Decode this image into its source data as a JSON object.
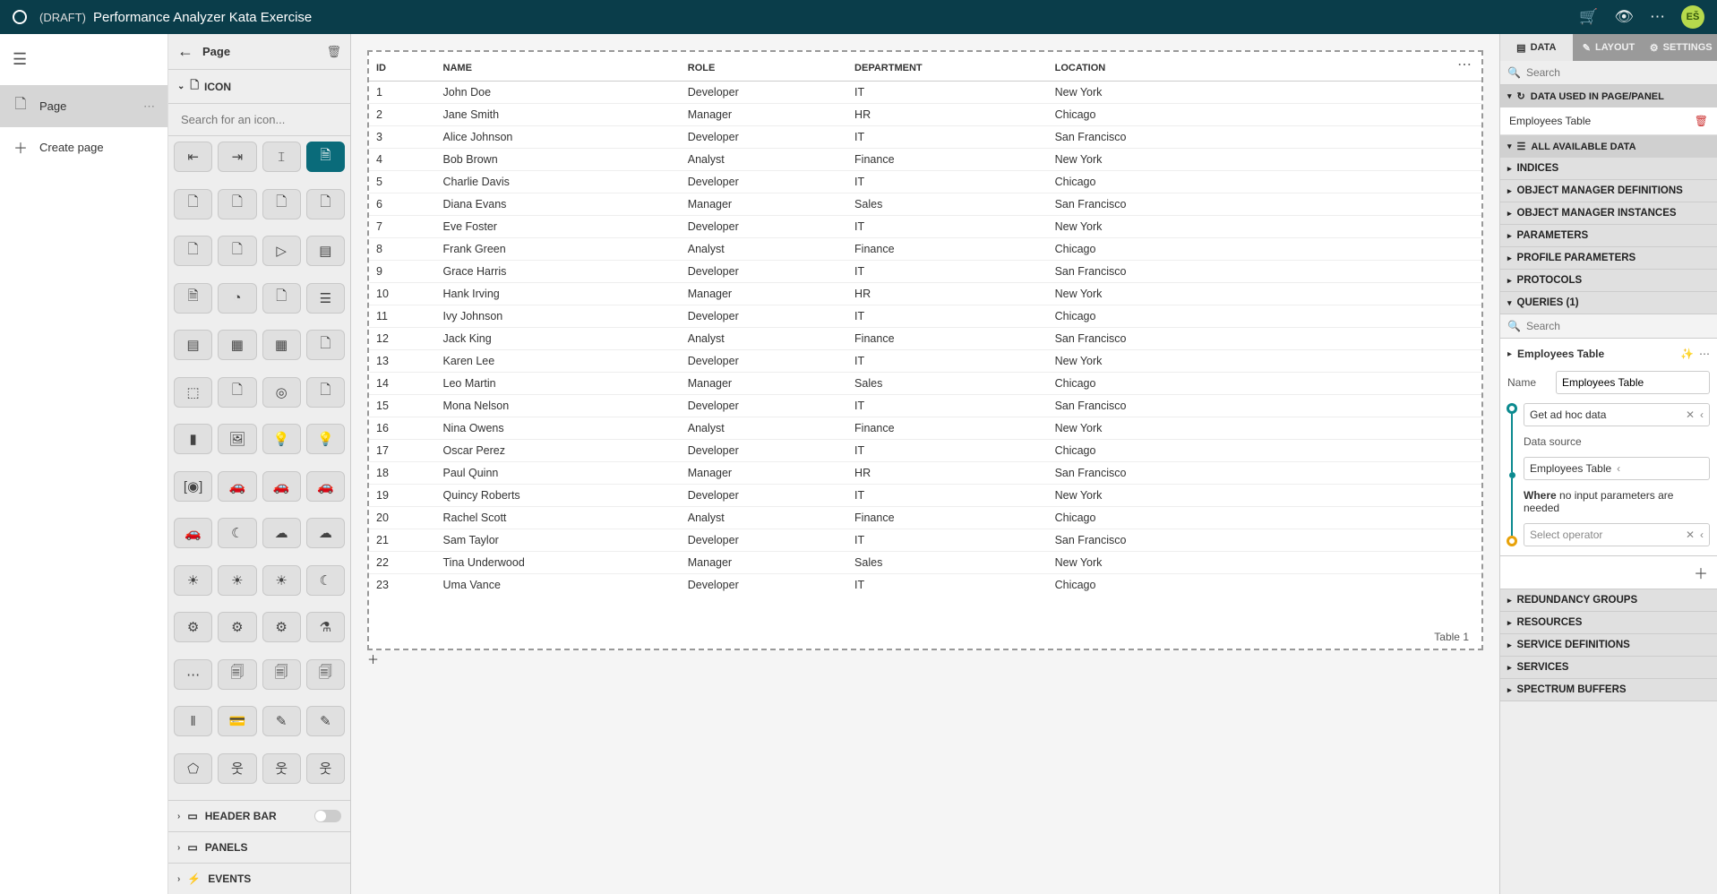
{
  "topbar": {
    "draft": "(DRAFT)",
    "title": "Performance Analyzer Kata Exercise",
    "avatar": "EŠ"
  },
  "nav": {
    "page": "Page",
    "create": "Create page"
  },
  "pagecol": {
    "title": "Page",
    "icon_section": "ICON",
    "search_placeholder": "Search for an icon...",
    "headerbar": "HEADER BAR",
    "panels": "PANELS",
    "events": "EVENTS",
    "icons": [
      "⇤",
      "⇥",
      "𝙸",
      "🗎",
      "🗋",
      "🗋",
      "🗋",
      "🗋",
      "🗋",
      "🗋",
      "▷",
      "▤",
      "🗎",
      "◔",
      "🗋",
      "☰",
      "▤",
      "▦",
      "▦",
      "🗋",
      "⬚",
      "🗋",
      "◎",
      "🗋",
      "▮",
      "🖼",
      "💡",
      "💡",
      "[◉]",
      "🚗",
      "🚗",
      "🚗",
      "🚗",
      "☾",
      "☁",
      "☁",
      "☀",
      "☀",
      "☀",
      "☾",
      "⚙",
      "⚙",
      "⚙",
      "⚗",
      "⋯",
      "🗐",
      "🗐",
      "🗐",
      "‖",
      "💳",
      "✎",
      "✎",
      "⬠",
      "웃",
      "웃",
      "웃"
    ]
  },
  "table": {
    "label": "Table 1",
    "headers": [
      "ID",
      "NAME",
      "ROLE",
      "DEPARTMENT",
      "LOCATION"
    ],
    "rows": [
      [
        "1",
        "John Doe",
        "Developer",
        "IT",
        "New York"
      ],
      [
        "2",
        "Jane Smith",
        "Manager",
        "HR",
        "Chicago"
      ],
      [
        "3",
        "Alice Johnson",
        "Developer",
        "IT",
        "San Francisco"
      ],
      [
        "4",
        "Bob Brown",
        "Analyst",
        "Finance",
        "New York"
      ],
      [
        "5",
        "Charlie Davis",
        "Developer",
        "IT",
        "Chicago"
      ],
      [
        "6",
        "Diana Evans",
        "Manager",
        "Sales",
        "San Francisco"
      ],
      [
        "7",
        "Eve Foster",
        "Developer",
        "IT",
        "New York"
      ],
      [
        "8",
        "Frank Green",
        "Analyst",
        "Finance",
        "Chicago"
      ],
      [
        "9",
        "Grace Harris",
        "Developer",
        "IT",
        "San Francisco"
      ],
      [
        "10",
        "Hank Irving",
        "Manager",
        "HR",
        "New York"
      ],
      [
        "11",
        "Ivy Johnson",
        "Developer",
        "IT",
        "Chicago"
      ],
      [
        "12",
        "Jack King",
        "Analyst",
        "Finance",
        "San Francisco"
      ],
      [
        "13",
        "Karen Lee",
        "Developer",
        "IT",
        "New York"
      ],
      [
        "14",
        "Leo Martin",
        "Manager",
        "Sales",
        "Chicago"
      ],
      [
        "15",
        "Mona Nelson",
        "Developer",
        "IT",
        "San Francisco"
      ],
      [
        "16",
        "Nina Owens",
        "Analyst",
        "Finance",
        "New York"
      ],
      [
        "17",
        "Oscar Perez",
        "Developer",
        "IT",
        "Chicago"
      ],
      [
        "18",
        "Paul Quinn",
        "Manager",
        "HR",
        "San Francisco"
      ],
      [
        "19",
        "Quincy Roberts",
        "Developer",
        "IT",
        "New York"
      ],
      [
        "20",
        "Rachel Scott",
        "Analyst",
        "Finance",
        "Chicago"
      ],
      [
        "21",
        "Sam Taylor",
        "Developer",
        "IT",
        "San Francisco"
      ],
      [
        "22",
        "Tina Underwood",
        "Manager",
        "Sales",
        "New York"
      ],
      [
        "23",
        "Uma Vance",
        "Developer",
        "IT",
        "Chicago"
      ]
    ]
  },
  "right": {
    "tabs": {
      "data": "DATA",
      "layout": "LAYOUT",
      "settings": "SETTINGS"
    },
    "search_placeholder": "Search",
    "data_used": "DATA USED IN PAGE/PANEL",
    "data_used_item": "Employees Table",
    "all_data": "ALL AVAILABLE DATA",
    "sections": {
      "indices": "INDICES",
      "omd": "OBJECT MANAGER DEFINITIONS",
      "omi": "OBJECT MANAGER INSTANCES",
      "params": "PARAMETERS",
      "pparams": "PROFILE PARAMETERS",
      "protocols": "PROTOCOLS",
      "queries": "QUERIES (1)",
      "redund": "REDUNDANCY GROUPS",
      "resources": "RESOURCES",
      "servdef": "SERVICE DEFINITIONS",
      "services": "SERVICES",
      "spectrum": "SPECTRUM BUFFERS"
    },
    "query": {
      "name": "Employees Table",
      "name_label": "Name",
      "name_value": "Employees Table",
      "step1": "Get ad hoc data",
      "ds_label": "Data source",
      "ds_value": "Employees Table",
      "where_bold": "Where",
      "where_rest": " no input parameters are needed",
      "step_select": "Select operator"
    },
    "qsearch_placeholder": "Search"
  }
}
